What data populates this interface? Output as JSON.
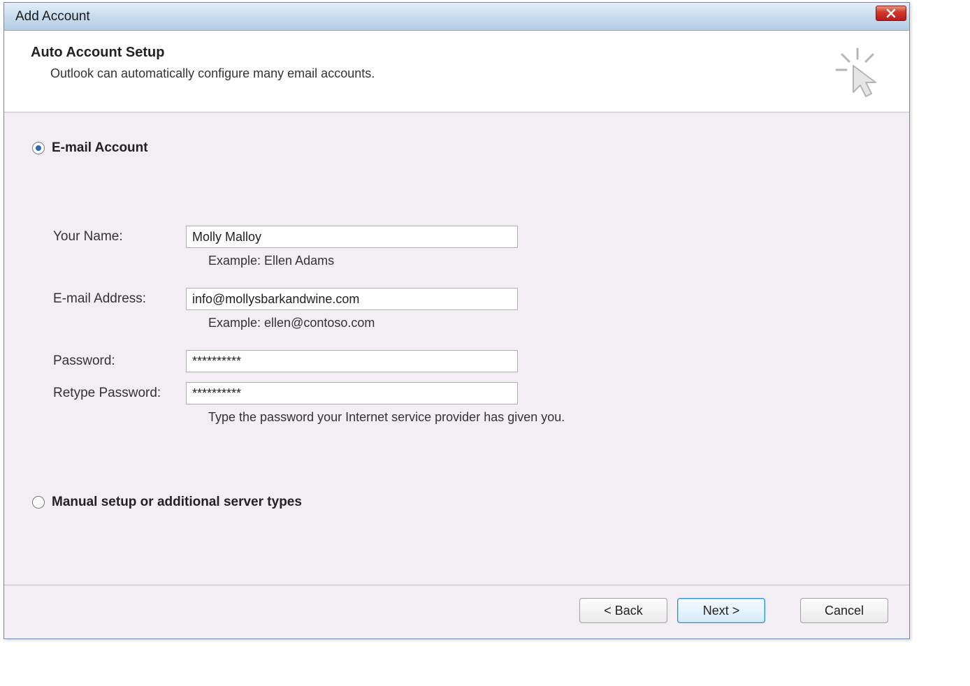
{
  "window": {
    "title": "Add Account"
  },
  "header": {
    "title": "Auto Account Setup",
    "subtitle": "Outlook can automatically configure many email accounts."
  },
  "options": {
    "email_account_label": "E-mail Account",
    "manual_setup_label": "Manual setup or additional server types"
  },
  "form": {
    "name_label": "Your Name:",
    "name_value": "Molly Malloy",
    "name_example": "Example: Ellen Adams",
    "email_label": "E-mail Address:",
    "email_value": "info@mollysbarkandwine.com",
    "email_example": "Example: ellen@contoso.com",
    "password_label": "Password:",
    "password_value": "**********",
    "retype_label": "Retype Password:",
    "retype_value": "**********",
    "password_hint": "Type the password your Internet service provider has given you."
  },
  "buttons": {
    "back": "< Back",
    "next": "Next >",
    "cancel": "Cancel"
  }
}
